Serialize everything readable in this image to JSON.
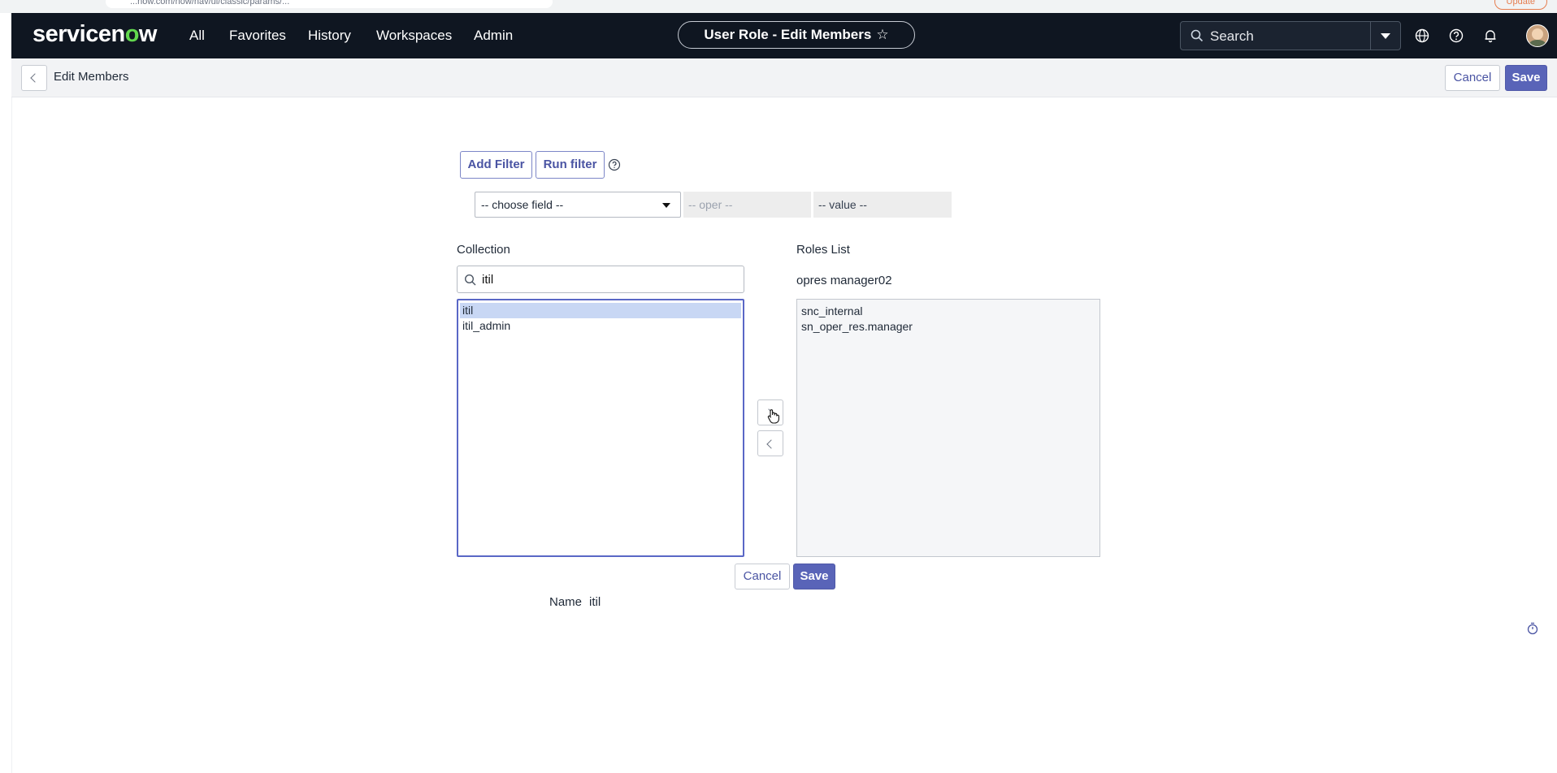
{
  "browser": {
    "url_text": "...now.com/now/nav/ui/classic/params/...",
    "update_label": "Update"
  },
  "topnav": {
    "logo_prefix": "servicen",
    "logo_o": "o",
    "logo_suffix": "w",
    "items": [
      "All",
      "Favorites",
      "History",
      "Workspaces",
      "Admin"
    ],
    "context_title": "User Role - Edit Members",
    "star_glyph": "☆",
    "search_placeholder": "Search",
    "icons": [
      "globe-icon",
      "help-icon",
      "bell-icon",
      "user-avatar"
    ]
  },
  "subheader": {
    "title": "Edit Members",
    "cancel_label": "Cancel",
    "save_label": "Save"
  },
  "filter": {
    "add_filter_label": "Add Filter",
    "run_filter_label": "Run filter",
    "field_placeholder": "-- choose field --",
    "oper_placeholder": "-- oper --",
    "value_placeholder": "-- value --"
  },
  "collection": {
    "label": "Collection",
    "search_value": "itil",
    "items": [
      "itil",
      "itil_admin"
    ],
    "selected_index": 0
  },
  "roles": {
    "label": "Roles List",
    "user_name": "opres manager02",
    "items": [
      "snc_internal",
      "sn_oper_res.manager"
    ]
  },
  "actions": {
    "cancel_label": "Cancel",
    "save_label": "Save"
  },
  "detail": {
    "name_label": "Name",
    "name_value": "itil"
  },
  "colors": {
    "nav_bg": "#0f1621",
    "accent": "#5964b8",
    "logo_green": "#62d84e"
  }
}
